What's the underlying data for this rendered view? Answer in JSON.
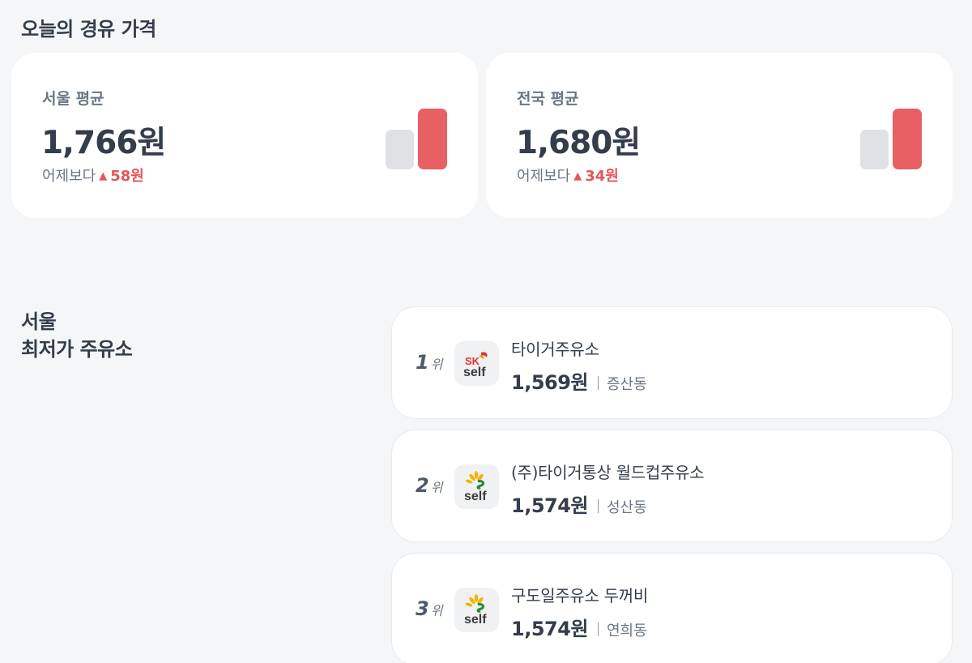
{
  "title": "오늘의 경유 가격",
  "averages": [
    {
      "label": "서울 평균",
      "price": "1,766원",
      "change_prefix": "어제보다",
      "change_icon": "▲",
      "change_value": "58원"
    },
    {
      "label": "전국 평균",
      "price": "1,680원",
      "change_prefix": "어제보다",
      "change_icon": "▲",
      "change_value": "34원"
    }
  ],
  "cheapest": {
    "title_line1": "서울",
    "title_line2": "최저가 주유소",
    "stations": [
      {
        "rank": "1",
        "rank_unit": "위",
        "logo": "sk-self-logo",
        "logo_text_top": "SK",
        "logo_text_bottom": "self",
        "name": "타이거주유소",
        "price": "1,569원",
        "area": "증산동"
      },
      {
        "rank": "2",
        "rank_unit": "위",
        "logo": "s-oil-self-logo",
        "logo_text_bottom": "self",
        "name": "(주)타이거통상 월드컵주유소",
        "price": "1,574원",
        "area": "성산동"
      },
      {
        "rank": "3",
        "rank_unit": "위",
        "logo": "s-oil-self-logo",
        "logo_text_bottom": "self",
        "name": "구도일주유소 두꺼비",
        "price": "1,574원",
        "area": "연희동"
      }
    ]
  },
  "colors": {
    "accent_red": "#e85f64",
    "change_red": "#e5555b",
    "bar_gray": "#dfe1e5"
  }
}
